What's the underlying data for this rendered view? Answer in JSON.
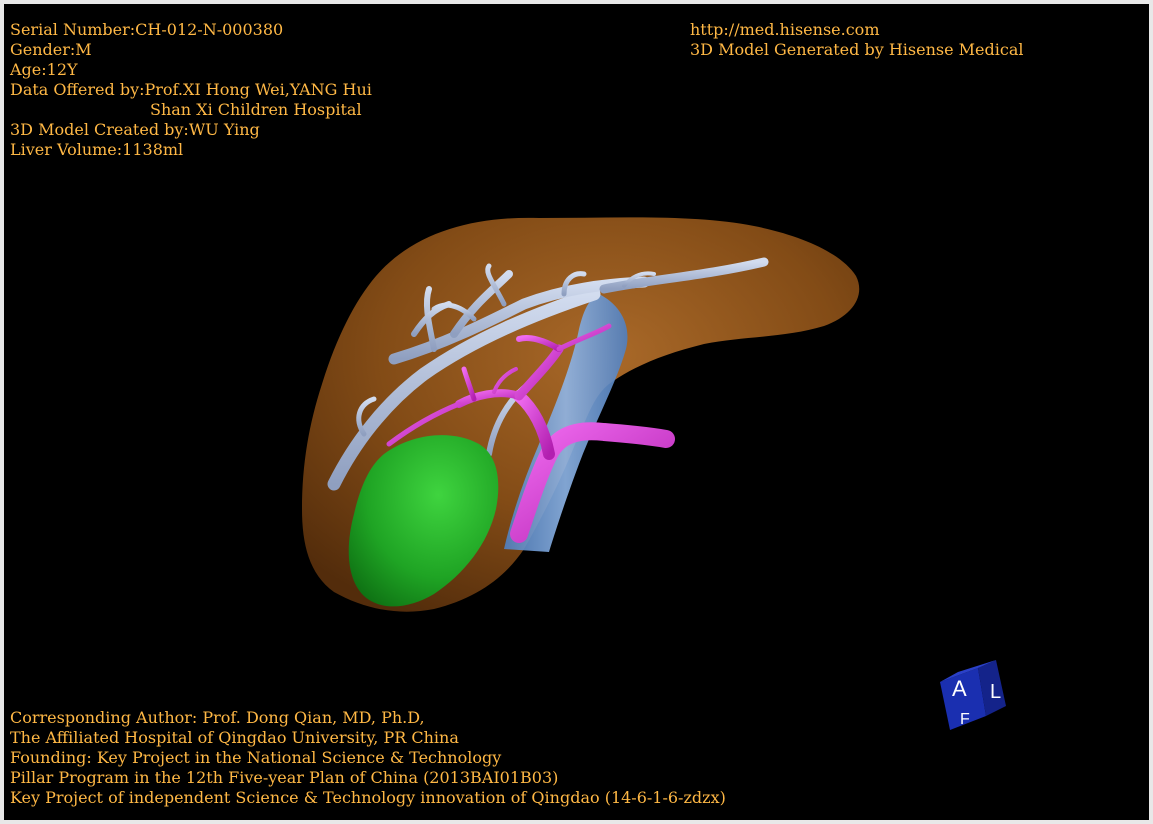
{
  "text_color": "#ffb845",
  "info": {
    "serial": "Serial Number:CH-012-N-000380",
    "gender": "Gender:M",
    "age": "Age:12Y",
    "data_offered": "Data Offered by:Prof.XI Hong Wei,YANG Hui",
    "hospital": "Shan Xi Children Hospital",
    "created_by": "3D Model Created by:WU Ying",
    "volume": "Liver Volume:1138ml"
  },
  "header_right": {
    "url": "http://med.hisense.com",
    "generated": "3D Model Generated by Hisense Medical"
  },
  "footer": {
    "line1": "Corresponding Author: Prof. Dong Qian, MD, Ph.D,",
    "line2": "The Affiliated Hospital of Qingdao University, PR China",
    "line3": "Founding: Key Project in the National Science & Technology",
    "line4": "Pillar Program in the 12th Five-year Plan of China (2013BAI01B03)",
    "line5": "Key Project of independent Science & Technology innovation of Qingdao (14-6-1-6-zdzx)"
  },
  "orientation_cube": {
    "front": "A",
    "side": "L",
    "top": "F"
  },
  "colors": {
    "liver": "#9a5a1c",
    "hepatic_vein": "#a9b8d6",
    "portal_vein": "#d43ad0",
    "vena_cava": "#6f9fd8",
    "tumor": "#22b22a",
    "cube": "#1a2fb0"
  }
}
